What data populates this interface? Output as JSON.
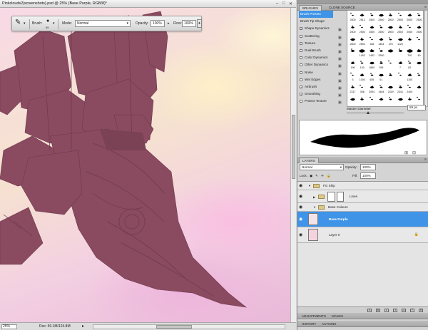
{
  "document": {
    "title": "Pinkclouds2(screenshots).psd @ 25% (Base Purple, RGB/8)*",
    "window_buttons": [
      "–",
      "□",
      "✕"
    ],
    "zoom": "25%",
    "doc_size": "Doc: 50.1M/124.8M"
  },
  "options_bar": {
    "brush_label": "Brush:",
    "brush_size": "59",
    "mode_label": "Mode:",
    "mode_value": "Normal",
    "opacity_label": "Opacity:",
    "opacity_value": "100%",
    "flow_label": "Flow:",
    "flow_value": "100%"
  },
  "brushes_panel": {
    "tabs": [
      "BRUSHES",
      "CLONE SOURCE"
    ],
    "presets_label": "Brush Presets",
    "tip_shape_label": "Brush Tip Shape",
    "options": [
      {
        "label": "Shape Dynamics",
        "checked": true
      },
      {
        "label": "Scattering",
        "checked": false
      },
      {
        "label": "Texture",
        "checked": false
      },
      {
        "label": "Dual Brush",
        "checked": false
      },
      {
        "label": "Color Dynamics",
        "checked": false
      },
      {
        "label": "Other Dynamics",
        "checked": false
      },
      {
        "label": "Noise",
        "checked": false
      },
      {
        "label": "Wet Edges",
        "checked": false
      },
      {
        "label": "Airbrush",
        "checked": true
      },
      {
        "label": "Smoothing",
        "checked": true
      },
      {
        "label": "Protect Texture",
        "checked": false
      }
    ],
    "grid_rows": [
      [
        "2500",
        "2512",
        "2500",
        "2500",
        "2500",
        "2500",
        "2500",
        "2500"
      ],
      [
        "2500",
        "2500",
        "2500",
        "2500",
        "2500",
        "2500",
        "2500",
        "2500"
      ],
      [
        "2500",
        "2500",
        "158",
        "1804",
        "476",
        "1120",
        "",
        ""
      ],
      [
        "",
        "1452",
        "1452",
        "2500",
        "",
        "",
        "700",
        "60"
      ],
      [
        "196",
        "100",
        "1860",
        "395",
        "",
        "7",
        "82",
        ""
      ],
      [
        "5",
        "1000",
        "455",
        "61",
        "",
        "",
        "1105",
        ""
      ],
      [
        "2317",
        "306",
        "2094",
        "1464",
        "2319",
        "2341",
        "2400",
        ""
      ],
      [
        "",
        "",
        "",
        "",
        "",
        "",
        "",
        ""
      ]
    ],
    "master_diameter_label": "Master Diameter",
    "master_diameter_value": "59 px"
  },
  "layers_panel": {
    "tab": "LAYERS",
    "blend_mode": "Normal",
    "opacity_label": "Opacity:",
    "opacity_value": "100%",
    "lock_label": "Lock:",
    "fill_label": "Fill:",
    "fill_value": "100%",
    "layers": [
      {
        "name": "FG Ship",
        "type": "group"
      },
      {
        "name": "Lines",
        "type": "layer"
      },
      {
        "name": "Base Colours",
        "type": "group"
      },
      {
        "name": "Base Purple",
        "type": "layer",
        "selected": true
      },
      {
        "name": "Layer 0",
        "type": "layer",
        "locked": true
      }
    ]
  },
  "bottom_tabs": {
    "adjustments": [
      "ADJUSTMENTS",
      "MASKS"
    ],
    "history": [
      "HISTORY",
      "ACTIONS"
    ]
  },
  "colors": {
    "ship": "#8a4a60",
    "selection_blue": "#3f94e8"
  }
}
